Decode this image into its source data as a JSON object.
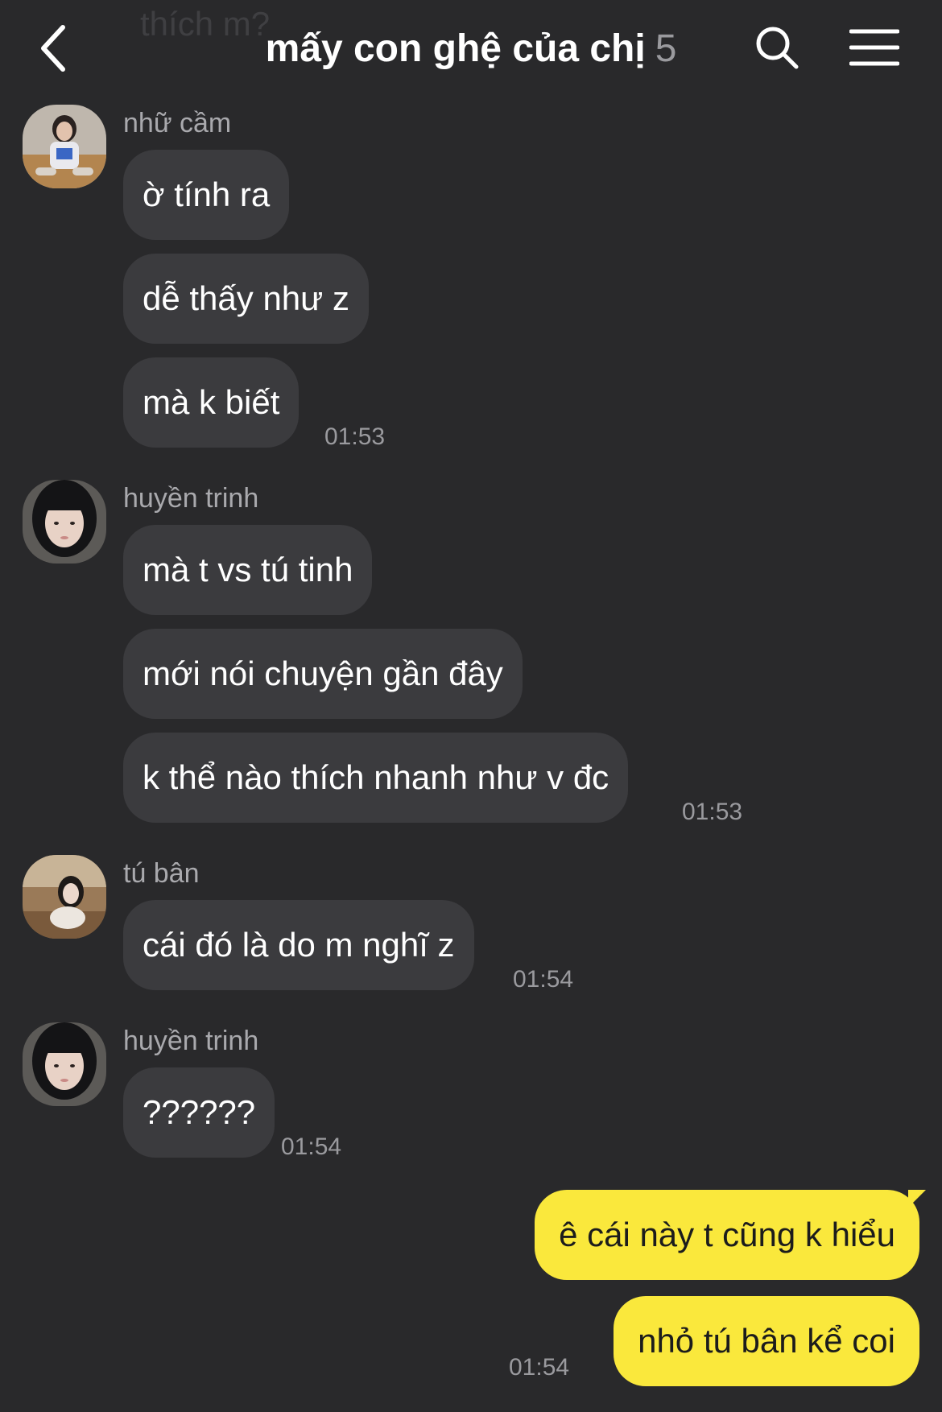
{
  "header": {
    "faded_text": "thích m?",
    "title": "mấy con ghệ của chị",
    "member_count": "5"
  },
  "icons": {
    "back": "chevron-left-icon",
    "search": "search-icon",
    "menu": "hamburger-menu-icon"
  },
  "colors": {
    "background": "#29292b",
    "incoming_bubble": "#3b3b3e",
    "outgoing_bubble": "#fae83c",
    "secondary_text": "#9a9a9e"
  },
  "messages": [
    {
      "sender": "nhữ cầm",
      "texts": [
        "ờ tính ra",
        "dễ thấy như z",
        "mà k biết"
      ],
      "time": "01:53"
    },
    {
      "sender": "huyền trinh",
      "texts": [
        "mà t vs tú tinh",
        "mới nói chuyện gần đây",
        "k thể nào thích nhanh như v đc"
      ],
      "time": "01:53"
    },
    {
      "sender": "tú bân",
      "texts": [
        "cái đó là do m nghĩ z"
      ],
      "time": "01:54"
    },
    {
      "sender": "huyền trinh",
      "texts": [
        "??????"
      ],
      "time": "01:54"
    }
  ],
  "my_messages": {
    "texts": [
      "ê cái này t cũng k hiểu",
      "nhỏ tú bân kể coi"
    ],
    "time": "01:54"
  }
}
